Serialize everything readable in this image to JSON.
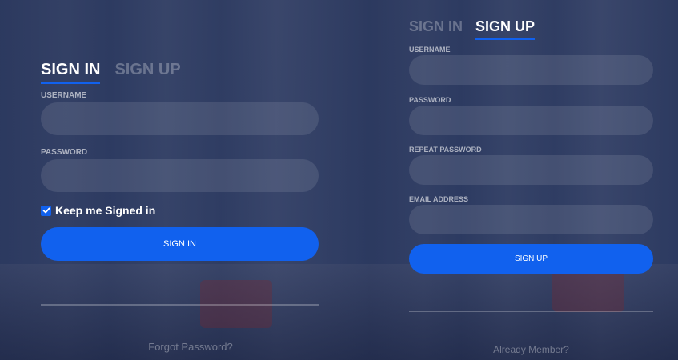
{
  "signin": {
    "tab_active": "SIGN IN",
    "tab_inactive": "SIGN UP",
    "username_label": "USERNAME",
    "password_label": "PASSWORD",
    "keep_signed_label": "Keep me Signed in",
    "keep_signed_checked": true,
    "submit_label": "SIGN IN",
    "forgot_link": "Forgot Password?"
  },
  "signup": {
    "tab_inactive": "SIGN IN",
    "tab_active": "SIGN UP",
    "username_label": "USERNAME",
    "password_label": "PASSWORD",
    "repeat_password_label": "REPEAT PASSWORD",
    "email_label": "EMAIL ADDRESS",
    "submit_label": "SIGN UP",
    "already_member_link": "Already Member?"
  },
  "colors": {
    "accent": "#1161ee",
    "overlay": "#283965"
  },
  "icons": {
    "checkbox": "check-icon"
  }
}
